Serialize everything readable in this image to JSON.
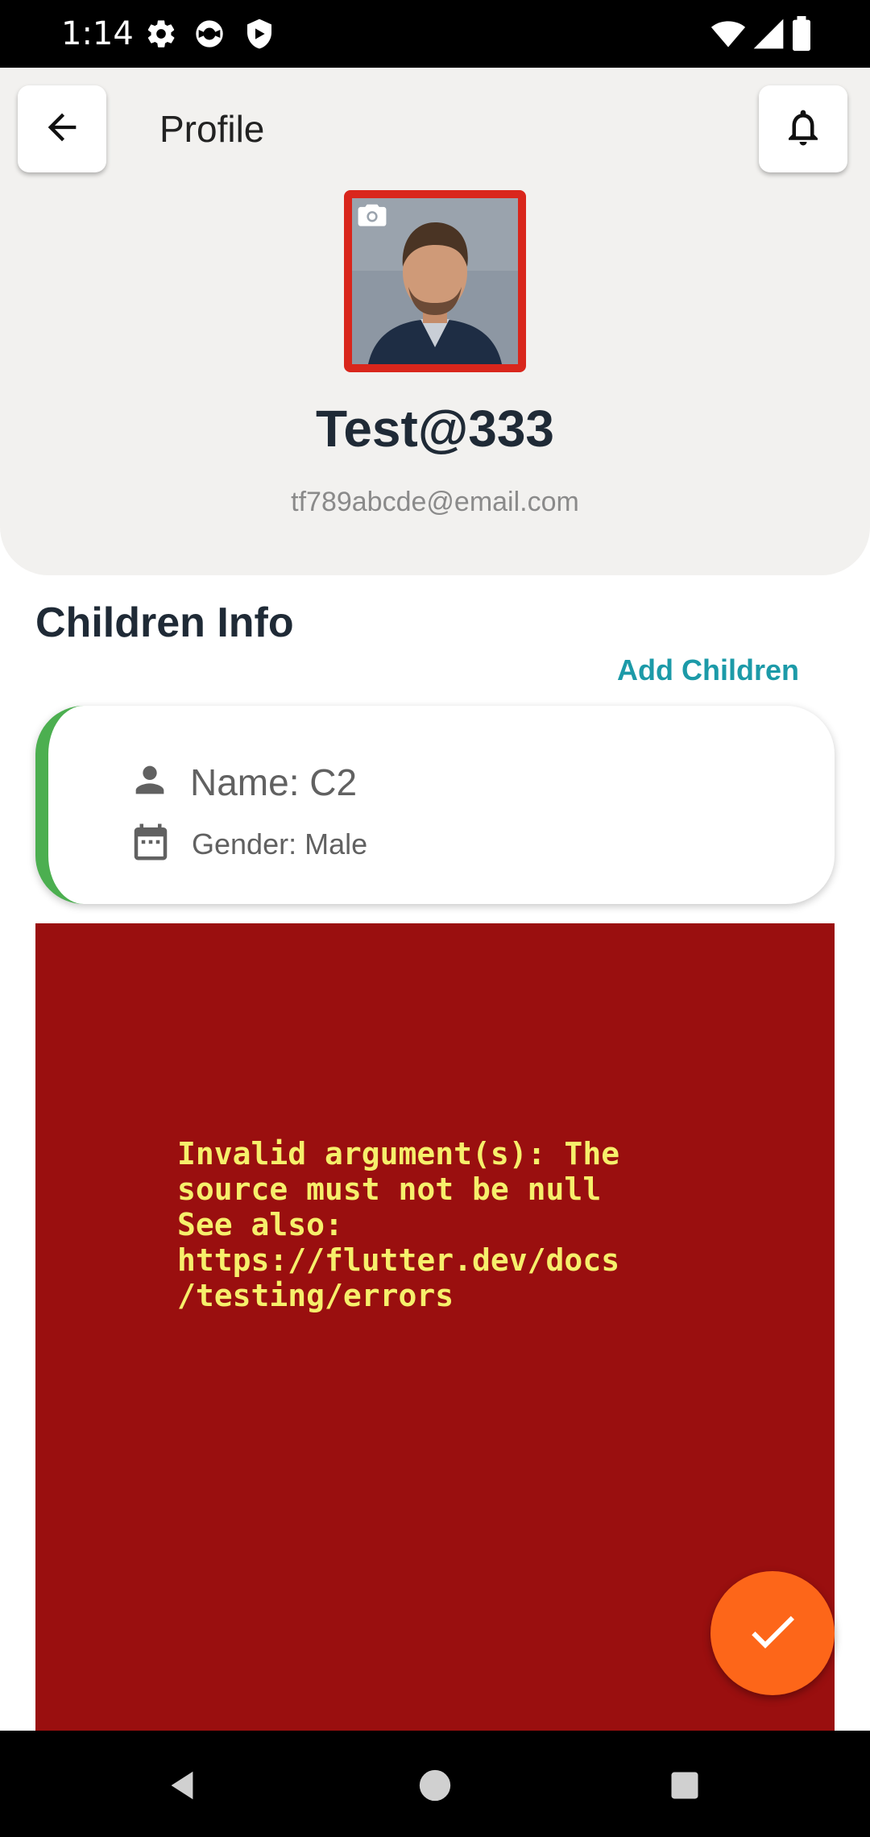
{
  "status_bar": {
    "time": "1:14",
    "left_icons": [
      "gear-icon",
      "sync-icon",
      "shield-icon"
    ],
    "right_icons": [
      "wifi-icon",
      "signal-icon",
      "battery-icon"
    ]
  },
  "app_bar": {
    "title": "Profile",
    "back_icon": "arrow-left-icon",
    "notification_icon": "bell-icon"
  },
  "profile": {
    "name": "Test@333",
    "email": "tf789abcde@email.com",
    "avatar_border_color": "#d9261c",
    "camera_icon": "camera-icon"
  },
  "children": {
    "section_title": "Children Info",
    "add_label": "Add Children",
    "items": [
      {
        "name": "Name: C2",
        "gender": "Gender: Male",
        "accent_color": "#4caf50"
      }
    ]
  },
  "error": {
    "message": "Invalid argument(s): The\nsource must not be null\nSee also:\nhttps://flutter.dev/docs\n/testing/errors",
    "background": "#9a0f0f",
    "text_color": "#f6ef6b"
  },
  "fab": {
    "icon": "check-icon",
    "color": "#fd6619"
  },
  "nav_bar": {
    "buttons": [
      "back-triangle-icon",
      "home-circle-icon",
      "recents-square-icon"
    ]
  }
}
